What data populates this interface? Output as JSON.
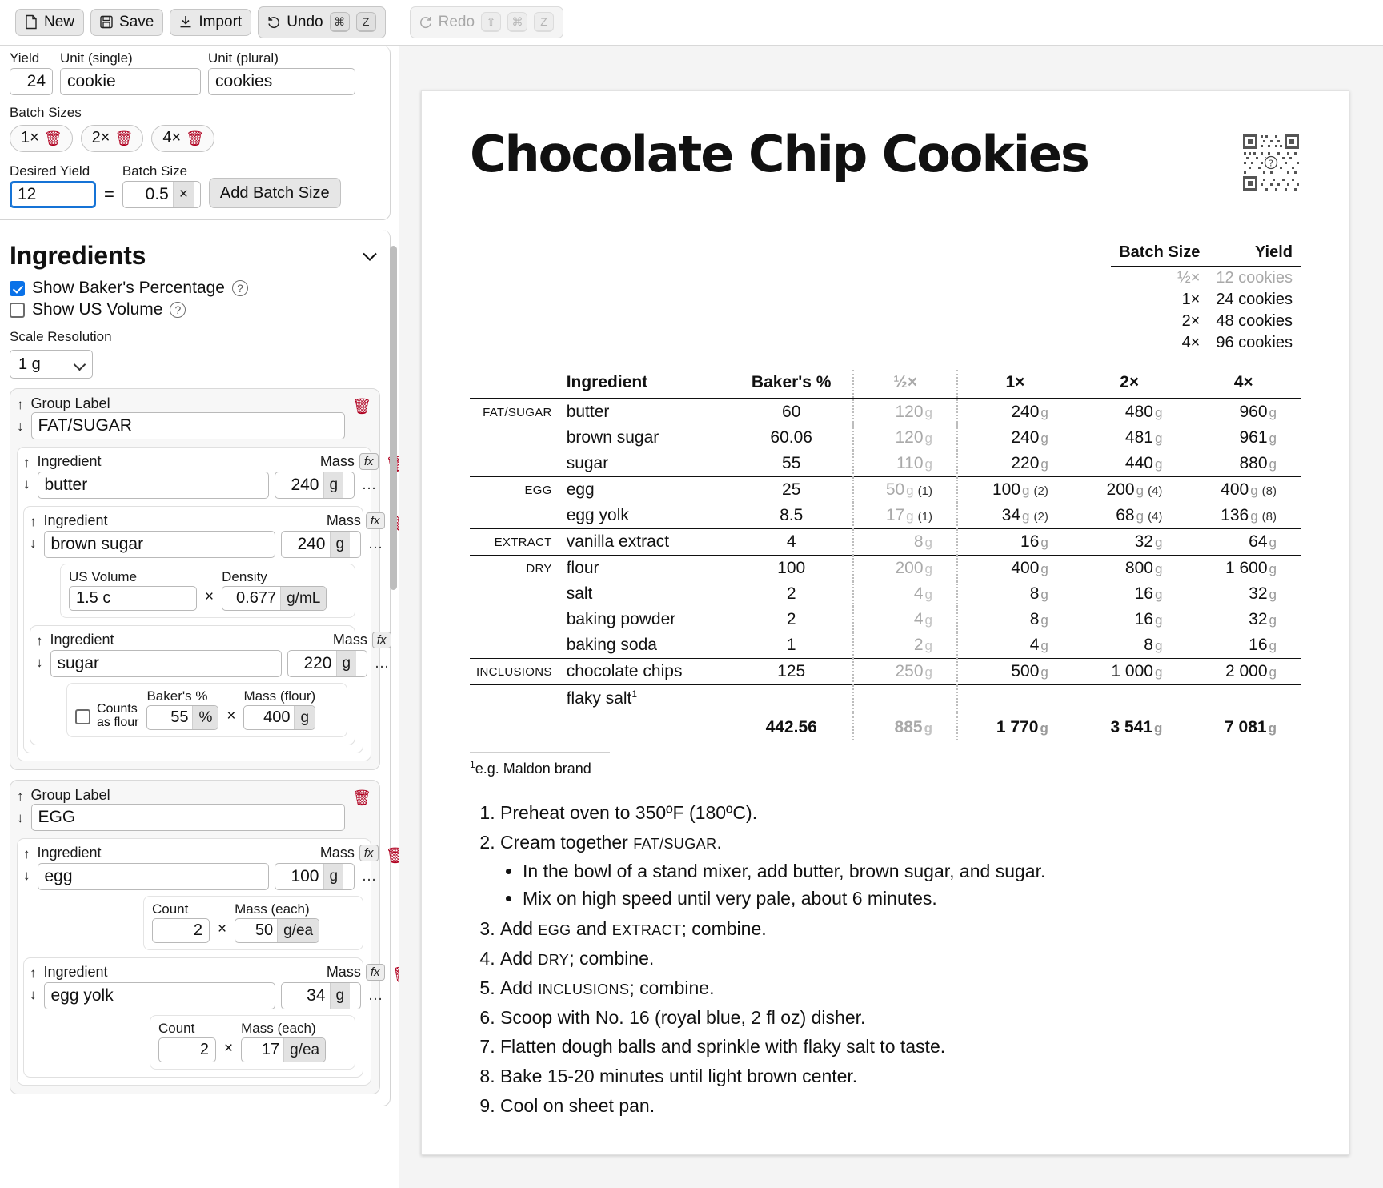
{
  "toolbar": {
    "new_label": "New",
    "save_label": "Save",
    "import_label": "Import",
    "undo_label": "Undo",
    "undo_keys": [
      "⌘",
      "Z"
    ],
    "redo_label": "Redo",
    "redo_keys": [
      "⇧",
      "⌘",
      "Z"
    ]
  },
  "sidebar": {
    "yield": {
      "yield_label": "Yield",
      "yield_value": "24",
      "unit_single_label": "Unit (single)",
      "unit_single_value": "cookie",
      "unit_plural_label": "Unit (plural)",
      "unit_plural_value": "cookies"
    },
    "batch": {
      "label": "Batch Sizes",
      "chips": [
        "1×",
        "2×",
        "4×"
      ],
      "desired_yield_label": "Desired Yield",
      "desired_yield_value": "12",
      "equals": "=",
      "batch_size_label": "Batch Size",
      "batch_size_value": "0.5",
      "batch_size_unit": "×",
      "add_label": "Add Batch Size"
    },
    "ingredients": {
      "title": "Ingredients",
      "show_bakers_pct_label": "Show Baker's Percentage",
      "show_bakers_pct_checked": true,
      "show_us_volume_label": "Show US Volume",
      "show_us_volume_checked": false,
      "scale_resolution_label": "Scale Resolution",
      "scale_resolution_value": "1 g",
      "scale_resolution_options": [
        "1 g"
      ],
      "group_label_caption": "Group Label",
      "ingredient_caption": "Ingredient",
      "mass_caption": "Mass",
      "fx_caption": "fx",
      "more_caption": "…",
      "groups": [
        {
          "name": "FAT/SUGAR",
          "items": [
            {
              "name": "butter",
              "mass": "240",
              "unit": "g",
              "extra": null
            },
            {
              "name": "brown sugar",
              "mass": "240",
              "unit": "g",
              "extra": {
                "type": "volume",
                "vol_label": "US Volume",
                "vol_value": "1.5 c",
                "times": "×",
                "den_label": "Density",
                "den_value": "0.677",
                "den_unit": "g/mL"
              }
            },
            {
              "name": "sugar",
              "mass": "220",
              "unit": "g",
              "extra": {
                "type": "flour",
                "counts_label_1": "Counts",
                "counts_label_2": "as flour",
                "checked": false,
                "pct_label": "Baker's %",
                "pct_value": "55",
                "pct_unit": "%",
                "times": "×",
                "flour_label": "Mass (flour)",
                "flour_value": "400",
                "flour_unit": "g"
              }
            }
          ]
        },
        {
          "name": "EGG",
          "items": [
            {
              "name": "egg",
              "mass": "100",
              "unit": "g",
              "extra": {
                "type": "count",
                "count_label": "Count",
                "count_value": "2",
                "times": "×",
                "each_label": "Mass (each)",
                "each_value": "50",
                "each_unit": "g/ea"
              }
            },
            {
              "name": "egg yolk",
              "mass": "34",
              "unit": "g",
              "extra": {
                "type": "count",
                "count_label": "Count",
                "count_value": "2",
                "times": "×",
                "each_label": "Mass (each)",
                "each_value": "17",
                "each_unit": "g/ea"
              }
            }
          ]
        }
      ]
    }
  },
  "recipe": {
    "title": "Chocolate Chip Cookies",
    "yield_table": {
      "headers": [
        "Batch Size",
        "Yield"
      ],
      "rows": [
        {
          "batch": "½×",
          "yield": "12 cookies",
          "muted": true
        },
        {
          "batch": "1×",
          "yield": "24 cookies",
          "muted": false
        },
        {
          "batch": "2×",
          "yield": "48 cookies",
          "muted": false
        },
        {
          "batch": "4×",
          "yield": "96 cookies",
          "muted": false
        }
      ]
    },
    "ingredient_table": {
      "headers": [
        "Ingredient",
        "Baker's %",
        "½×",
        "1×",
        "2×",
        "4×"
      ],
      "rows": [
        {
          "group": "FAT/SUGAR",
          "name": "butter",
          "pct": "60",
          "half": "120",
          "half_unit": "g",
          "x1": "240",
          "x1_unit": "g",
          "x2": "480",
          "x2_unit": "g",
          "x4": "960",
          "x4_unit": "g",
          "half_ct": "",
          "x1_ct": "",
          "x2_ct": "",
          "x4_ct": "",
          "end": false
        },
        {
          "group": "",
          "name": "brown sugar",
          "pct": "60.06",
          "half": "120",
          "half_unit": "g",
          "x1": "240",
          "x1_unit": "g",
          "x2": "481",
          "x2_unit": "g",
          "x4": "961",
          "x4_unit": "g",
          "half_ct": "",
          "x1_ct": "",
          "x2_ct": "",
          "x4_ct": "",
          "end": false
        },
        {
          "group": "",
          "name": "sugar",
          "pct": "55",
          "half": "110",
          "half_unit": "g",
          "x1": "220",
          "x1_unit": "g",
          "x2": "440",
          "x2_unit": "g",
          "x4": "880",
          "x4_unit": "g",
          "half_ct": "",
          "x1_ct": "",
          "x2_ct": "",
          "x4_ct": "",
          "end": true
        },
        {
          "group": "EGG",
          "name": "egg",
          "pct": "25",
          "half": "50",
          "half_unit": "g",
          "x1": "100",
          "x1_unit": "g",
          "x2": "200",
          "x2_unit": "g",
          "x4": "400",
          "x4_unit": "g",
          "half_ct": "(1)",
          "x1_ct": "(2)",
          "x2_ct": "(4)",
          "x4_ct": "(8)",
          "end": false
        },
        {
          "group": "",
          "name": "egg yolk",
          "pct": "8.5",
          "half": "17",
          "half_unit": "g",
          "x1": "34",
          "x1_unit": "g",
          "x2": "68",
          "x2_unit": "g",
          "x4": "136",
          "x4_unit": "g",
          "half_ct": "(1)",
          "x1_ct": "(2)",
          "x2_ct": "(4)",
          "x4_ct": "(8)",
          "end": true
        },
        {
          "group": "EXTRACT",
          "name": "vanilla extract",
          "pct": "4",
          "half": "8",
          "half_unit": "g",
          "x1": "16",
          "x1_unit": "g",
          "x2": "32",
          "x2_unit": "g",
          "x4": "64",
          "x4_unit": "g",
          "half_ct": "",
          "x1_ct": "",
          "x2_ct": "",
          "x4_ct": "",
          "end": true
        },
        {
          "group": "DRY",
          "name": "flour",
          "pct": "100",
          "half": "200",
          "half_unit": "g",
          "x1": "400",
          "x1_unit": "g",
          "x2": "800",
          "x2_unit": "g",
          "x4": "1 600",
          "x4_unit": "g",
          "half_ct": "",
          "x1_ct": "",
          "x2_ct": "",
          "x4_ct": "",
          "end": false
        },
        {
          "group": "",
          "name": "salt",
          "pct": "2",
          "half": "4",
          "half_unit": "g",
          "x1": "8",
          "x1_unit": "g",
          "x2": "16",
          "x2_unit": "g",
          "x4": "32",
          "x4_unit": "g",
          "half_ct": "",
          "x1_ct": "",
          "x2_ct": "",
          "x4_ct": "",
          "end": false
        },
        {
          "group": "",
          "name": "baking powder",
          "pct": "2",
          "half": "4",
          "half_unit": "g",
          "x1": "8",
          "x1_unit": "g",
          "x2": "16",
          "x2_unit": "g",
          "x4": "32",
          "x4_unit": "g",
          "half_ct": "",
          "x1_ct": "",
          "x2_ct": "",
          "x4_ct": "",
          "end": false
        },
        {
          "group": "",
          "name": "baking soda",
          "pct": "1",
          "half": "2",
          "half_unit": "g",
          "x1": "4",
          "x1_unit": "g",
          "x2": "8",
          "x2_unit": "g",
          "x4": "16",
          "x4_unit": "g",
          "half_ct": "",
          "x1_ct": "",
          "x2_ct": "",
          "x4_ct": "",
          "end": true
        },
        {
          "group": "INCLUSIONS",
          "name": "chocolate chips",
          "pct": "125",
          "half": "250",
          "half_unit": "g",
          "x1": "500",
          "x1_unit": "g",
          "x2": "1 000",
          "x2_unit": "g",
          "x4": "2 000",
          "x4_unit": "g",
          "half_ct": "",
          "x1_ct": "",
          "x2_ct": "",
          "x4_ct": "",
          "end": true
        },
        {
          "group": "",
          "name": "flaky salt",
          "pct": "",
          "half": "",
          "half_unit": "",
          "x1": "",
          "x1_unit": "",
          "x2": "",
          "x2_unit": "",
          "x4": "",
          "x4_unit": "",
          "half_ct": "",
          "x1_ct": "",
          "x2_ct": "",
          "x4_ct": "",
          "end": true,
          "footnote": "1"
        }
      ],
      "totals": {
        "pct": "442.56",
        "half": "885",
        "half_unit": "g",
        "x1": "1 770",
        "x1_unit": "g",
        "x2": "3 541",
        "x2_unit": "g",
        "x4": "7 081",
        "x4_unit": "g"
      }
    },
    "footnote": {
      "marker": "1",
      "text": "e.g. Maldon brand"
    },
    "steps": [
      {
        "text": "Preheat oven to 350ºF (180ºC).",
        "sub": []
      },
      {
        "text": "Cream together FAT/SUGAR.",
        "pre": "Cream together ",
        "sc": "FAT/SUGAR",
        "post": ".",
        "sub": [
          "In the bowl of a stand mixer, add butter, brown sugar, and sugar.",
          "Mix on high speed until very pale, about 6 minutes."
        ]
      },
      {
        "text": "Add EGG and EXTRACT; combine.",
        "pre": "Add ",
        "sc": "EGG",
        "mid": " and ",
        "sc2": "EXTRACT",
        "post": "; combine.",
        "sub": []
      },
      {
        "text": "Add DRY; combine.",
        "pre": "Add ",
        "sc": "DRY",
        "post": "; combine.",
        "sub": []
      },
      {
        "text": "Add INCLUSIONS; combine.",
        "pre": "Add ",
        "sc": "INCLUSIONS",
        "post": "; combine.",
        "sub": []
      },
      {
        "text": "Scoop with No. 16 (royal blue, 2 fl oz) disher.",
        "sub": []
      },
      {
        "text": "Flatten dough balls and sprinkle with flaky salt to taste.",
        "sub": []
      },
      {
        "text": "Bake 15-20 minutes until light brown center.",
        "sub": []
      },
      {
        "text": "Cool on sheet pan.",
        "sub": []
      }
    ]
  },
  "colors": {
    "accent": "#0a72e8",
    "danger": "#b00020",
    "muted": "#a8a8a8"
  }
}
